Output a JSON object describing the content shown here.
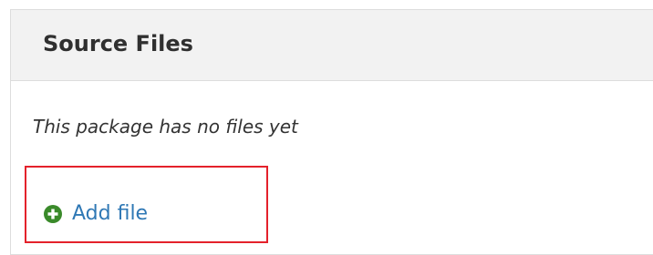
{
  "panel": {
    "title": "Source Files",
    "empty_message": "This package has no files yet",
    "add_link": {
      "label": "Add file",
      "icon": "plus-circle-icon"
    }
  },
  "colors": {
    "header_bg": "#f2f2f2",
    "link": "#2f78b5",
    "add_icon": "#3a8a2a",
    "highlight_border": "#e4212b"
  }
}
